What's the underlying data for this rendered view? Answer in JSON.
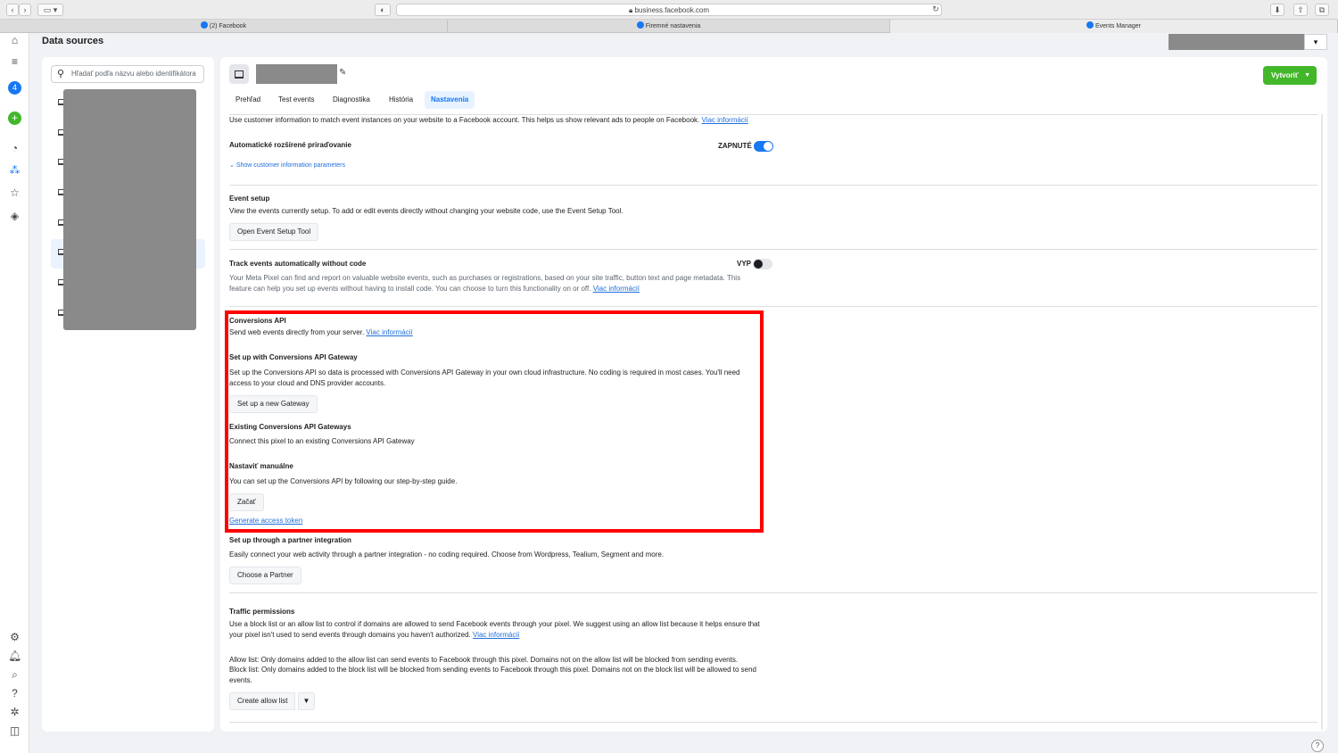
{
  "browser": {
    "url": "business.facebook.com",
    "tabs": [
      {
        "label": "(2) Facebook"
      },
      {
        "label": "Firemné nastavenia"
      },
      {
        "label": "Events Manager"
      }
    ]
  },
  "header": {
    "title": "Data sources"
  },
  "sidebar": {
    "search_placeholder": "Hľadať podľa názvu alebo identifikátora"
  },
  "pixel": {
    "tabs": [
      "Prehľad",
      "Test events",
      "Diagnostika",
      "História",
      "Nastavenia"
    ],
    "active_tab": "Nastavenia",
    "create_label": "Vytvoriť"
  },
  "settings": {
    "cust_info_desc": "Use customer information to match event instances on your website to a Facebook account. This helps us show relevant ads to people on Facebook.",
    "more_info": "Viac informácií",
    "auto_match_title": "Automatické rozšírené priraďovanie",
    "auto_match_state": "ZAPNUTÉ",
    "show_params": "Show customer information parameters",
    "event_setup_title": "Event setup",
    "event_setup_desc": "View the events currently setup. To add or edit events directly without changing your website code, use the Event Setup Tool.",
    "open_tool_btn": "Open Event Setup Tool",
    "track_title": "Track events automatically without code",
    "track_state": "VYP",
    "track_desc_1": "Your Meta Pixel can find and report on valuable website events, such as purchases or registrations, based on your site traffic, button text and page metadata. This",
    "track_desc_2": "feature can help you set up events without having to install code. You can choose to turn this functionality on or off.",
    "capi_title": "Conversions API",
    "capi_desc": "Send web events directly from your server.",
    "gateway_title": "Set up with Conversions API Gateway",
    "gateway_desc_1": "Set up the Conversions API so data is processed with Conversions API Gateway in your own cloud infrastructure. No coding is required in most cases. You'll need",
    "gateway_desc_2": "access to your cloud and DNS provider accounts.",
    "gateway_btn": "Set up a new Gateway",
    "existing_title": "Existing Conversions API Gateways",
    "existing_desc": "Connect this pixel to an existing Conversions API Gateway",
    "manual_title": "Nastaviť manuálne",
    "manual_desc": "You can set up the Conversions API by following our step-by-step guide.",
    "manual_btn": "Začať",
    "token_link": "Generate access token",
    "partner_title": "Set up through a partner integration",
    "partner_desc": "Easily connect your web activity through a partner integration - no coding required. Choose from Wordpress, Tealium, Segment and more.",
    "partner_btn": "Choose a Partner",
    "traffic_title": "Traffic permissions",
    "traffic_desc_1": "Use a block list or an allow list to control if domains are allowed to send Facebook events through your pixel. We suggest using an allow list because it helps ensure that",
    "traffic_desc_2": "your pixel isn't used to send events through domains you haven't authorized.",
    "allow_desc": "Allow list: Only domains added to the allow list can send events to Facebook through this pixel. Domains not on the allow list will be blocked from sending events.",
    "block_desc_1": "Block list: Only domains added to the block list will be blocked from sending events to Facebook through this pixel. Domains not on the block list will be allowed to send",
    "block_desc_2": "events.",
    "allow_btn": "Create allow list"
  },
  "colors": {
    "accent": "#1877f2",
    "create": "#42b72a",
    "highlight": "#ff0000"
  }
}
